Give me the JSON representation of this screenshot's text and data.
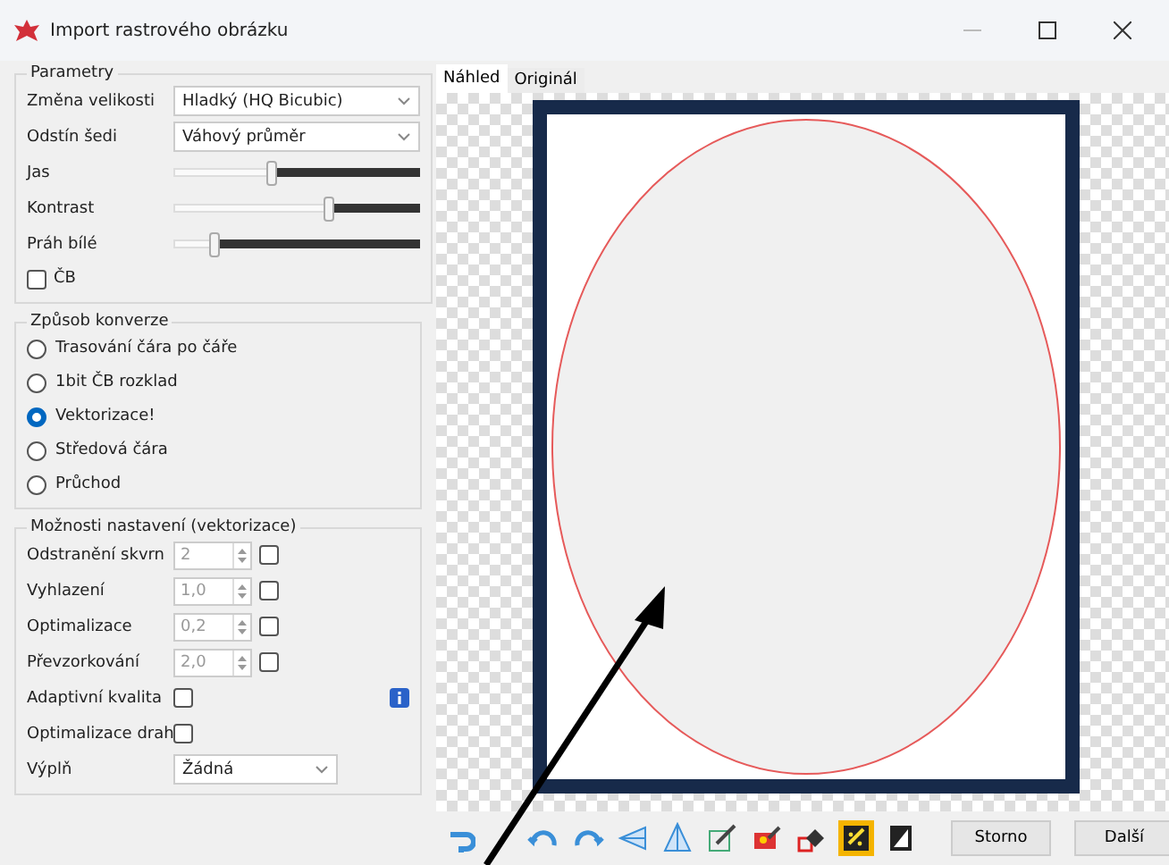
{
  "window": {
    "title": "Import rastrového obrázku"
  },
  "parameters": {
    "title": "Parametry",
    "dropdowns": [
      {
        "label": "Změna velikosti",
        "value": "Hladký (HQ Bicubic)"
      },
      {
        "label": "Odstín šedi",
        "value": "Váhový průměr"
      }
    ],
    "sliders": [
      {
        "label": "Jas",
        "level": 0.4
      },
      {
        "label": "Kontrast",
        "level": 0.63
      },
      {
        "label": "Práh bílé",
        "level": 0.17
      }
    ],
    "checkbox": {
      "label": "ČB",
      "checked": false
    }
  },
  "conversion": {
    "title": "Způsob konverze",
    "options": [
      {
        "label": "Trasování čára po čáře",
        "selected": false
      },
      {
        "label": "1bit ČB rozklad",
        "selected": false
      },
      {
        "label": "Vektorizace!",
        "selected": true
      },
      {
        "label": "Středová čára",
        "selected": false
      },
      {
        "label": "Průchod",
        "selected": false
      }
    ]
  },
  "options": {
    "title": "Možnosti nastavení (vektorizace)",
    "spinners": [
      {
        "label": "Odstranění skvrn",
        "value": "2",
        "disabled": true,
        "checked": false
      },
      {
        "label": "Vyhlazení",
        "value": "1,0",
        "disabled": true,
        "checked": false
      },
      {
        "label": "Optimalizace",
        "value": "0,2",
        "disabled": true,
        "checked": false
      },
      {
        "label": "Převzorkování",
        "value": "2,0",
        "disabled": true,
        "checked": false
      }
    ],
    "checkboxes": [
      {
        "label": "Adaptivní kvalita",
        "checked": false
      },
      {
        "label": "Optimalizace drah",
        "checked": false
      }
    ],
    "info_button": true,
    "fill": {
      "label": "Výplň",
      "value": "Žádná"
    }
  },
  "tabs": [
    {
      "label": "Náhled",
      "selected": true
    },
    {
      "label": "Originál",
      "selected": false
    }
  ],
  "toolbar": [
    {
      "kind": "undo",
      "selected": false
    },
    {
      "kind": "rotate-left",
      "selected": false
    },
    {
      "kind": "rotate-right",
      "selected": false
    },
    {
      "kind": "flip-horizontal",
      "selected": false
    },
    {
      "kind": "flip-vertical",
      "selected": false
    },
    {
      "kind": "crop",
      "selected": false
    },
    {
      "kind": "color",
      "selected": false
    },
    {
      "kind": "fill",
      "selected": false
    },
    {
      "kind": "trace",
      "selected": true
    },
    {
      "kind": "invert",
      "selected": false
    }
  ],
  "buttons": [
    "Storno",
    "Další"
  ]
}
